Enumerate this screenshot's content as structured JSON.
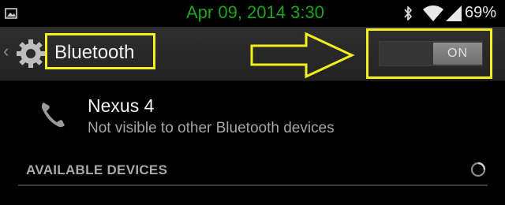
{
  "status_bar": {
    "left_icon": "gallery-notification-icon",
    "time": "Apr 09, 2014 3:30",
    "time_color": "#1aa51a",
    "icons": [
      "bluetooth-icon",
      "wifi-icon",
      "cell-signal-icon"
    ],
    "battery": "69%"
  },
  "action_bar": {
    "up_icon": "back-caret-icon",
    "app_icon": "gear-icon",
    "title": "Bluetooth",
    "toggle": {
      "state_label": "ON",
      "on": true
    }
  },
  "annotations": {
    "highlight_color": "#f2ef1e",
    "arrow": "right-arrow-annotation"
  },
  "device": {
    "icon": "phone-icon",
    "name": "Nexus 4",
    "visibility": "Not visible to other Bluetooth devices"
  },
  "available_section": {
    "header": "AVAILABLE DEVICES",
    "scanning_icon": "spinner-icon"
  }
}
